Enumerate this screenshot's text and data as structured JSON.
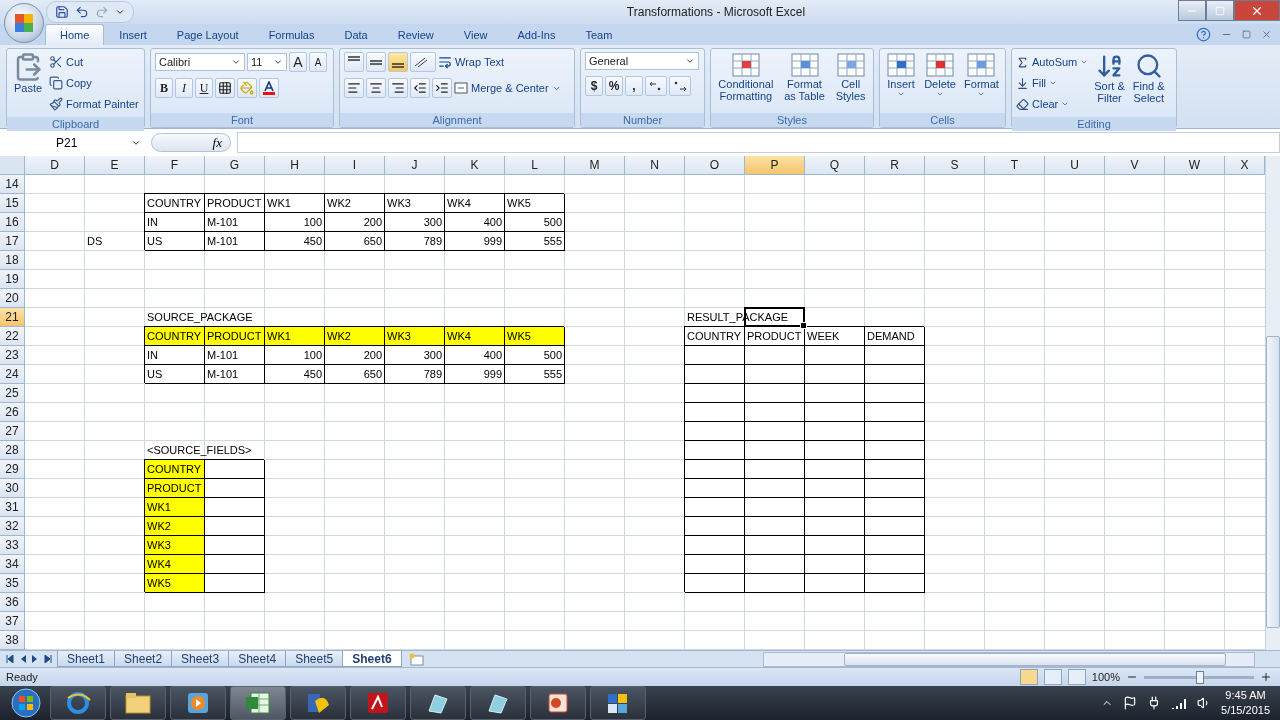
{
  "window": {
    "title": "Transformations - Microsoft Excel"
  },
  "ribbon_tabs": [
    {
      "label": "Home",
      "selected": true
    },
    {
      "label": "Insert",
      "selected": false
    },
    {
      "label": "Page Layout",
      "selected": false
    },
    {
      "label": "Formulas",
      "selected": false
    },
    {
      "label": "Data",
      "selected": false
    },
    {
      "label": "Review",
      "selected": false
    },
    {
      "label": "View",
      "selected": false
    },
    {
      "label": "Add-Ins",
      "selected": false
    },
    {
      "label": "Team",
      "selected": false
    }
  ],
  "ribbon_groups": [
    {
      "kind": "clipboard",
      "label": "Clipboard",
      "big": "Paste",
      "items": [
        "Cut",
        "Copy",
        "Format Painter"
      ]
    },
    {
      "kind": "font",
      "label": "Font",
      "font": "Calibri",
      "size": "11",
      "grow": "A",
      "shrink": "A",
      "styles": [
        "B",
        "I",
        "U"
      ]
    },
    {
      "kind": "alignment",
      "label": "Alignment",
      "vertical_align": [
        {
          "selected": false
        },
        {
          "selected": false
        },
        {
          "selected": true
        }
      ],
      "items": [
        "Wrap Text",
        "Merge & Center"
      ]
    },
    {
      "kind": "number",
      "label": "Number",
      "format": "General",
      "symbols": [
        "$",
        "%",
        ","
      ]
    },
    {
      "kind": "styles",
      "label": "Styles",
      "buttons": [
        [
          "Conditional",
          "Formatting"
        ],
        [
          "Format",
          "as Table"
        ],
        [
          "Cell",
          "Styles"
        ]
      ]
    },
    {
      "kind": "cells",
      "label": "Cells",
      "buttons": [
        "Insert",
        "Delete",
        "Format"
      ]
    },
    {
      "kind": "editing",
      "label": "Editing",
      "items": [
        "AutoSum",
        "Fill",
        "Clear"
      ],
      "buttons": [
        [
          "Sort &",
          "Filter"
        ],
        [
          "Find &",
          "Select"
        ]
      ]
    }
  ],
  "formula_bar": {
    "name_box": "P21",
    "function_label": "fx"
  },
  "columns": [
    {
      "label": "D",
      "selected": false
    },
    {
      "label": "E",
      "selected": false
    },
    {
      "label": "F",
      "selected": false
    },
    {
      "label": "G",
      "selected": false
    },
    {
      "label": "H",
      "selected": false
    },
    {
      "label": "I",
      "selected": false
    },
    {
      "label": "J",
      "selected": false
    },
    {
      "label": "K",
      "selected": false
    },
    {
      "label": "L",
      "selected": false
    },
    {
      "label": "M",
      "selected": false
    },
    {
      "label": "N",
      "selected": false
    },
    {
      "label": "O",
      "selected": false
    },
    {
      "label": "P",
      "selected": true
    },
    {
      "label": "Q",
      "selected": false
    },
    {
      "label": "R",
      "selected": false
    },
    {
      "label": "S",
      "selected": false
    },
    {
      "label": "T",
      "selected": false
    },
    {
      "label": "U",
      "selected": false
    },
    {
      "label": "V",
      "selected": false
    },
    {
      "label": "W",
      "selected": false
    },
    {
      "label": "X",
      "selected": false
    }
  ],
  "rows": [
    {
      "number": "14",
      "selected": false,
      "cells": []
    },
    {
      "number": "15",
      "selected": false,
      "cells": [
        {
          "kind": "blank"
        },
        {
          "kind": "blank"
        },
        {
          "kind": "text",
          "text": "COUNTRY",
          "highlighted": false,
          "bordered": true
        },
        {
          "kind": "text",
          "text": "PRODUCT",
          "highlighted": false,
          "bordered": true
        },
        {
          "kind": "text",
          "text": "WK1",
          "highlighted": false,
          "bordered": true
        },
        {
          "kind": "text",
          "text": "WK2",
          "highlighted": false,
          "bordered": true
        },
        {
          "kind": "text",
          "text": "WK3",
          "highlighted": false,
          "bordered": true
        },
        {
          "kind": "text",
          "text": "WK4",
          "highlighted": false,
          "bordered": true
        },
        {
          "kind": "text",
          "text": "WK5",
          "highlighted": false,
          "bordered": true
        }
      ]
    },
    {
      "number": "16",
      "selected": false,
      "cells": [
        {
          "kind": "blank"
        },
        {
          "kind": "blank"
        },
        {
          "kind": "text",
          "text": "IN",
          "highlighted": false,
          "bordered": true
        },
        {
          "kind": "text",
          "text": "M-101",
          "highlighted": false,
          "bordered": true
        },
        {
          "kind": "number",
          "text": "100",
          "highlighted": false,
          "bordered": true
        },
        {
          "kind": "number",
          "text": "200",
          "highlighted": false,
          "bordered": true
        },
        {
          "kind": "number",
          "text": "300",
          "highlighted": false,
          "bordered": true
        },
        {
          "kind": "number",
          "text": "400",
          "highlighted": false,
          "bordered": true
        },
        {
          "kind": "number",
          "text": "500",
          "highlighted": false,
          "bordered": true
        }
      ]
    },
    {
      "number": "17",
      "selected": false,
      "cells": [
        {
          "kind": "blank"
        },
        {
          "kind": "text",
          "text": "DS",
          "highlighted": false,
          "bordered": false
        },
        {
          "kind": "text",
          "text": "US",
          "highlighted": false,
          "bordered": true
        },
        {
          "kind": "text",
          "text": "M-101",
          "highlighted": false,
          "bordered": true
        },
        {
          "kind": "number",
          "text": "450",
          "highlighted": false,
          "bordered": true
        },
        {
          "kind": "number",
          "text": "650",
          "highlighted": false,
          "bordered": true
        },
        {
          "kind": "number",
          "text": "789",
          "highlighted": false,
          "bordered": true
        },
        {
          "kind": "number",
          "text": "999",
          "highlighted": false,
          "bordered": true
        },
        {
          "kind": "number",
          "text": "555",
          "highlighted": false,
          "bordered": true
        }
      ]
    },
    {
      "number": "18",
      "selected": false,
      "cells": []
    },
    {
      "number": "19",
      "selected": false,
      "cells": []
    },
    {
      "number": "20",
      "selected": false,
      "cells": []
    },
    {
      "number": "21",
      "selected": true,
      "cells": [
        {
          "kind": "blank"
        },
        {
          "kind": "blank"
        },
        {
          "kind": "label",
          "text": "SOURCE_PACKAGE",
          "highlighted": false,
          "bordered": false
        },
        {
          "kind": "blank"
        },
        {
          "kind": "blank"
        },
        {
          "kind": "blank"
        },
        {
          "kind": "blank"
        },
        {
          "kind": "blank"
        },
        {
          "kind": "blank"
        },
        {
          "kind": "blank"
        },
        {
          "kind": "blank"
        },
        {
          "kind": "label",
          "text": "RESULT_PACKAGE",
          "highlighted": false,
          "bordered": false
        }
      ]
    },
    {
      "number": "22",
      "selected": false,
      "cells": [
        {
          "kind": "blank"
        },
        {
          "kind": "blank"
        },
        {
          "kind": "text",
          "text": "COUNTRY",
          "highlighted": true,
          "bordered": true
        },
        {
          "kind": "text",
          "text": "PRODUCT",
          "highlighted": true,
          "bordered": true
        },
        {
          "kind": "text",
          "text": "WK1",
          "highlighted": true,
          "bordered": true
        },
        {
          "kind": "text",
          "text": "WK2",
          "highlighted": true,
          "bordered": true
        },
        {
          "kind": "text",
          "text": "WK3",
          "highlighted": true,
          "bordered": true
        },
        {
          "kind": "text",
          "text": "WK4",
          "highlighted": true,
          "bordered": true
        },
        {
          "kind": "text",
          "text": "WK5",
          "highlighted": true,
          "bordered": true
        },
        {
          "kind": "blank"
        },
        {
          "kind": "blank"
        },
        {
          "kind": "text",
          "text": "COUNTRY",
          "highlighted": false,
          "bordered": true
        },
        {
          "kind": "text",
          "text": "PRODUCT",
          "highlighted": false,
          "bordered": true
        },
        {
          "kind": "text",
          "text": "WEEK",
          "highlighted": false,
          "bordered": true
        },
        {
          "kind": "text",
          "text": "DEMAND",
          "highlighted": false,
          "bordered": true
        }
      ]
    },
    {
      "number": "23",
      "selected": false,
      "cells": [
        {
          "kind": "blank"
        },
        {
          "kind": "blank"
        },
        {
          "kind": "text",
          "text": "IN",
          "highlighted": false,
          "bordered": true
        },
        {
          "kind": "text",
          "text": "M-101",
          "highlighted": false,
          "bordered": true
        },
        {
          "kind": "number",
          "text": "100",
          "highlighted": false,
          "bordered": true
        },
        {
          "kind": "number",
          "text": "200",
          "highlighted": false,
          "bordered": true
        },
        {
          "kind": "number",
          "text": "300",
          "highlighted": false,
          "bordered": true
        },
        {
          "kind": "number",
          "text": "400",
          "highlighted": false,
          "bordered": true
        },
        {
          "kind": "number",
          "text": "500",
          "highlighted": false,
          "bordered": true
        },
        {
          "kind": "blank"
        },
        {
          "kind": "blank"
        },
        {
          "kind": "empty",
          "highlighted": false,
          "bordered": true
        },
        {
          "kind": "empty",
          "highlighted": false,
          "bordered": true
        },
        {
          "kind": "empty",
          "highlighted": false,
          "bordered": true
        },
        {
          "kind": "empty",
          "highlighted": false,
          "bordered": true
        }
      ]
    },
    {
      "number": "24",
      "selected": false,
      "cells": [
        {
          "kind": "blank"
        },
        {
          "kind": "blank"
        },
        {
          "kind": "text",
          "text": "US",
          "highlighted": false,
          "bordered": true
        },
        {
          "kind": "text",
          "text": "M-101",
          "highlighted": false,
          "bordered": true
        },
        {
          "kind": "number",
          "text": "450",
          "highlighted": false,
          "bordered": true
        },
        {
          "kind": "number",
          "text": "650",
          "highlighted": false,
          "bordered": true
        },
        {
          "kind": "number",
          "text": "789",
          "highlighted": false,
          "bordered": true
        },
        {
          "kind": "number",
          "text": "999",
          "highlighted": false,
          "bordered": true
        },
        {
          "kind": "number",
          "text": "555",
          "highlighted": false,
          "bordered": true
        },
        {
          "kind": "blank"
        },
        {
          "kind": "blank"
        },
        {
          "kind": "empty",
          "highlighted": false,
          "bordered": true
        },
        {
          "kind": "empty",
          "highlighted": false,
          "bordered": true
        },
        {
          "kind": "empty",
          "highlighted": false,
          "bordered": true
        },
        {
          "kind": "empty",
          "highlighted": false,
          "bordered": true
        }
      ]
    },
    {
      "number": "25",
      "selected": false,
      "cells": [
        {
          "kind": "blank"
        },
        {
          "kind": "blank"
        },
        {
          "kind": "blank"
        },
        {
          "kind": "blank"
        },
        {
          "kind": "blank"
        },
        {
          "kind": "blank"
        },
        {
          "kind": "blank"
        },
        {
          "kind": "blank"
        },
        {
          "kind": "blank"
        },
        {
          "kind": "blank"
        },
        {
          "kind": "blank"
        },
        {
          "kind": "empty",
          "highlighted": false,
          "bordered": true
        },
        {
          "kind": "empty",
          "highlighted": false,
          "bordered": true
        },
        {
          "kind": "empty",
          "highlighted": false,
          "bordered": true
        },
        {
          "kind": "empty",
          "highlighted": false,
          "bordered": true
        }
      ]
    },
    {
      "number": "26",
      "selected": false,
      "cells": [
        {
          "kind": "blank"
        },
        {
          "kind": "blank"
        },
        {
          "kind": "blank"
        },
        {
          "kind": "blank"
        },
        {
          "kind": "blank"
        },
        {
          "kind": "blank"
        },
        {
          "kind": "blank"
        },
        {
          "kind": "blank"
        },
        {
          "kind": "blank"
        },
        {
          "kind": "blank"
        },
        {
          "kind": "blank"
        },
        {
          "kind": "empty",
          "highlighted": false,
          "bordered": true
        },
        {
          "kind": "empty",
          "highlighted": false,
          "bordered": true
        },
        {
          "kind": "empty",
          "highlighted": false,
          "bordered": true
        },
        {
          "kind": "empty",
          "highlighted": false,
          "bordered": true
        }
      ]
    },
    {
      "number": "27",
      "selected": false,
      "cells": [
        {
          "kind": "blank"
        },
        {
          "kind": "blank"
        },
        {
          "kind": "blank"
        },
        {
          "kind": "blank"
        },
        {
          "kind": "blank"
        },
        {
          "kind": "blank"
        },
        {
          "kind": "blank"
        },
        {
          "kind": "blank"
        },
        {
          "kind": "blank"
        },
        {
          "kind": "blank"
        },
        {
          "kind": "blank"
        },
        {
          "kind": "empty",
          "highlighted": false,
          "bordered": true
        },
        {
          "kind": "empty",
          "highlighted": false,
          "bordered": true
        },
        {
          "kind": "empty",
          "highlighted": false,
          "bordered": true
        },
        {
          "kind": "empty",
          "highlighted": false,
          "bordered": true
        }
      ]
    },
    {
      "number": "28",
      "selected": false,
      "cells": [
        {
          "kind": "blank"
        },
        {
          "kind": "blank"
        },
        {
          "kind": "label",
          "text": "<SOURCE_FIELDS>",
          "highlighted": false,
          "bordered": false
        },
        {
          "kind": "blank"
        },
        {
          "kind": "blank"
        },
        {
          "kind": "blank"
        },
        {
          "kind": "blank"
        },
        {
          "kind": "blank"
        },
        {
          "kind": "blank"
        },
        {
          "kind": "blank"
        },
        {
          "kind": "blank"
        },
        {
          "kind": "empty",
          "highlighted": false,
          "bordered": true
        },
        {
          "kind": "empty",
          "highlighted": false,
          "bordered": true
        },
        {
          "kind": "empty",
          "highlighted": false,
          "bordered": true
        },
        {
          "kind": "empty",
          "highlighted": false,
          "bordered": true
        }
      ]
    },
    {
      "number": "29",
      "selected": false,
      "cells": [
        {
          "kind": "blank"
        },
        {
          "kind": "blank"
        },
        {
          "kind": "text",
          "text": "COUNTRY",
          "highlighted": true,
          "bordered": true
        },
        {
          "kind": "empty",
          "highlighted": false,
          "bordered": true
        },
        {
          "kind": "blank"
        },
        {
          "kind": "blank"
        },
        {
          "kind": "blank"
        },
        {
          "kind": "blank"
        },
        {
          "kind": "blank"
        },
        {
          "kind": "blank"
        },
        {
          "kind": "blank"
        },
        {
          "kind": "empty",
          "highlighted": false,
          "bordered": true
        },
        {
          "kind": "empty",
          "highlighted": false,
          "bordered": true
        },
        {
          "kind": "empty",
          "highlighted": false,
          "bordered": true
        },
        {
          "kind": "empty",
          "highlighted": false,
          "bordered": true
        }
      ]
    },
    {
      "number": "30",
      "selected": false,
      "cells": [
        {
          "kind": "blank"
        },
        {
          "kind": "blank"
        },
        {
          "kind": "text",
          "text": "PRODUCT",
          "highlighted": true,
          "bordered": true
        },
        {
          "kind": "empty",
          "highlighted": false,
          "bordered": true
        },
        {
          "kind": "blank"
        },
        {
          "kind": "blank"
        },
        {
          "kind": "blank"
        },
        {
          "kind": "blank"
        },
        {
          "kind": "blank"
        },
        {
          "kind": "blank"
        },
        {
          "kind": "blank"
        },
        {
          "kind": "empty",
          "highlighted": false,
          "bordered": true
        },
        {
          "kind": "empty",
          "highlighted": false,
          "bordered": true
        },
        {
          "kind": "empty",
          "highlighted": false,
          "bordered": true
        },
        {
          "kind": "empty",
          "highlighted": false,
          "bordered": true
        }
      ]
    },
    {
      "number": "31",
      "selected": false,
      "cells": [
        {
          "kind": "blank"
        },
        {
          "kind": "blank"
        },
        {
          "kind": "text",
          "text": "WK1",
          "highlighted": true,
          "bordered": true
        },
        {
          "kind": "empty",
          "highlighted": false,
          "bordered": true
        },
        {
          "kind": "blank"
        },
        {
          "kind": "blank"
        },
        {
          "kind": "blank"
        },
        {
          "kind": "blank"
        },
        {
          "kind": "blank"
        },
        {
          "kind": "blank"
        },
        {
          "kind": "blank"
        },
        {
          "kind": "empty",
          "highlighted": false,
          "bordered": true
        },
        {
          "kind": "empty",
          "highlighted": false,
          "bordered": true
        },
        {
          "kind": "empty",
          "highlighted": false,
          "bordered": true
        },
        {
          "kind": "empty",
          "highlighted": false,
          "bordered": true
        }
      ]
    },
    {
      "number": "32",
      "selected": false,
      "cells": [
        {
          "kind": "blank"
        },
        {
          "kind": "blank"
        },
        {
          "kind": "text",
          "text": "WK2",
          "highlighted": true,
          "bordered": true
        },
        {
          "kind": "empty",
          "highlighted": false,
          "bordered": true
        },
        {
          "kind": "blank"
        },
        {
          "kind": "blank"
        },
        {
          "kind": "blank"
        },
        {
          "kind": "blank"
        },
        {
          "kind": "blank"
        },
        {
          "kind": "blank"
        },
        {
          "kind": "blank"
        },
        {
          "kind": "empty",
          "highlighted": false,
          "bordered": true
        },
        {
          "kind": "empty",
          "highlighted": false,
          "bordered": true
        },
        {
          "kind": "empty",
          "highlighted": false,
          "bordered": true
        },
        {
          "kind": "empty",
          "highlighted": false,
          "bordered": true
        }
      ]
    },
    {
      "number": "33",
      "selected": false,
      "cells": [
        {
          "kind": "blank"
        },
        {
          "kind": "blank"
        },
        {
          "kind": "text",
          "text": "WK3",
          "highlighted": true,
          "bordered": true
        },
        {
          "kind": "empty",
          "highlighted": false,
          "bordered": true
        },
        {
          "kind": "blank"
        },
        {
          "kind": "blank"
        },
        {
          "kind": "blank"
        },
        {
          "kind": "blank"
        },
        {
          "kind": "blank"
        },
        {
          "kind": "blank"
        },
        {
          "kind": "blank"
        },
        {
          "kind": "empty",
          "highlighted": false,
          "bordered": true
        },
        {
          "kind": "empty",
          "highlighted": false,
          "bordered": true
        },
        {
          "kind": "empty",
          "highlighted": false,
          "bordered": true
        },
        {
          "kind": "empty",
          "highlighted": false,
          "bordered": true
        }
      ]
    },
    {
      "number": "34",
      "selected": false,
      "cells": [
        {
          "kind": "blank"
        },
        {
          "kind": "blank"
        },
        {
          "kind": "text",
          "text": "WK4",
          "highlighted": true,
          "bordered": true
        },
        {
          "kind": "empty",
          "highlighted": false,
          "bordered": true
        },
        {
          "kind": "blank"
        },
        {
          "kind": "blank"
        },
        {
          "kind": "blank"
        },
        {
          "kind": "blank"
        },
        {
          "kind": "blank"
        },
        {
          "kind": "blank"
        },
        {
          "kind": "blank"
        },
        {
          "kind": "empty",
          "highlighted": false,
          "bordered": true
        },
        {
          "kind": "empty",
          "highlighted": false,
          "bordered": true
        },
        {
          "kind": "empty",
          "highlighted": false,
          "bordered": true
        },
        {
          "kind": "empty",
          "highlighted": false,
          "bordered": true
        }
      ]
    },
    {
      "number": "35",
      "selected": false,
      "cells": [
        {
          "kind": "blank"
        },
        {
          "kind": "blank"
        },
        {
          "kind": "text",
          "text": "WK5",
          "highlighted": true,
          "bordered": true
        },
        {
          "kind": "empty",
          "highlighted": false,
          "bordered": true
        },
        {
          "kind": "blank"
        },
        {
          "kind": "blank"
        },
        {
          "kind": "blank"
        },
        {
          "kind": "blank"
        },
        {
          "kind": "blank"
        },
        {
          "kind": "blank"
        },
        {
          "kind": "blank"
        },
        {
          "kind": "empty",
          "highlighted": false,
          "bordered": true
        },
        {
          "kind": "empty",
          "highlighted": false,
          "bordered": true
        },
        {
          "kind": "empty",
          "highlighted": false,
          "bordered": true
        },
        {
          "kind": "empty",
          "highlighted": false,
          "bordered": true
        }
      ]
    },
    {
      "number": "36",
      "selected": false,
      "cells": []
    },
    {
      "number": "37",
      "selected": false,
      "cells": []
    },
    {
      "number": "38",
      "selected": false,
      "cells": []
    }
  ],
  "sheet_tabs": [
    {
      "label": "Sheet1",
      "selected": false
    },
    {
      "label": "Sheet2",
      "selected": false
    },
    {
      "label": "Sheet3",
      "selected": false
    },
    {
      "label": "Sheet4",
      "selected": false
    },
    {
      "label": "Sheet5",
      "selected": false
    },
    {
      "label": "Sheet6",
      "selected": true
    }
  ],
  "status_bar": {
    "status": "Ready",
    "zoom": "100%",
    "zoom_slider": {
      "level": 0.5
    }
  },
  "clock": {
    "time": "9:45 AM",
    "date": "5/15/2015"
  }
}
